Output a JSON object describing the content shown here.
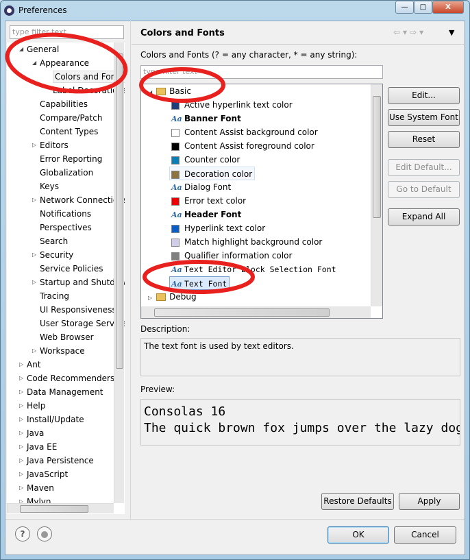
{
  "window": {
    "title": "Preferences",
    "minimize": "—",
    "maximize": "□",
    "close": "X"
  },
  "left": {
    "filter_placeholder": "type filter text",
    "tree": [
      {
        "label": "General",
        "level": 0,
        "arrow": "expanded"
      },
      {
        "label": "Appearance",
        "level": 1,
        "arrow": "expanded"
      },
      {
        "label": "Colors and Fonts",
        "level": 2,
        "arrow": "none",
        "selected": true
      },
      {
        "label": "Label Decorations",
        "level": 2,
        "arrow": "none"
      },
      {
        "label": "Capabilities",
        "level": 1,
        "arrow": "none"
      },
      {
        "label": "Compare/Patch",
        "level": 1,
        "arrow": "none"
      },
      {
        "label": "Content Types",
        "level": 1,
        "arrow": "none"
      },
      {
        "label": "Editors",
        "level": 1,
        "arrow": "collapsed"
      },
      {
        "label": "Error Reporting",
        "level": 1,
        "arrow": "none"
      },
      {
        "label": "Globalization",
        "level": 1,
        "arrow": "none"
      },
      {
        "label": "Keys",
        "level": 1,
        "arrow": "none"
      },
      {
        "label": "Network Connections",
        "level": 1,
        "arrow": "collapsed"
      },
      {
        "label": "Notifications",
        "level": 1,
        "arrow": "none"
      },
      {
        "label": "Perspectives",
        "level": 1,
        "arrow": "none"
      },
      {
        "label": "Search",
        "level": 1,
        "arrow": "none"
      },
      {
        "label": "Security",
        "level": 1,
        "arrow": "collapsed"
      },
      {
        "label": "Service Policies",
        "level": 1,
        "arrow": "none"
      },
      {
        "label": "Startup and Shutdown",
        "level": 1,
        "arrow": "collapsed"
      },
      {
        "label": "Tracing",
        "level": 1,
        "arrow": "none"
      },
      {
        "label": "UI Responsiveness",
        "level": 1,
        "arrow": "none"
      },
      {
        "label": "User Storage Service",
        "level": 1,
        "arrow": "none"
      },
      {
        "label": "Web Browser",
        "level": 1,
        "arrow": "none"
      },
      {
        "label": "Workspace",
        "level": 1,
        "arrow": "collapsed"
      },
      {
        "label": "Ant",
        "level": 0,
        "arrow": "collapsed"
      },
      {
        "label": "Code Recommenders",
        "level": 0,
        "arrow": "collapsed"
      },
      {
        "label": "Data Management",
        "level": 0,
        "arrow": "collapsed"
      },
      {
        "label": "Help",
        "level": 0,
        "arrow": "collapsed"
      },
      {
        "label": "Install/Update",
        "level": 0,
        "arrow": "collapsed"
      },
      {
        "label": "Java",
        "level": 0,
        "arrow": "collapsed"
      },
      {
        "label": "Java EE",
        "level": 0,
        "arrow": "collapsed"
      },
      {
        "label": "Java Persistence",
        "level": 0,
        "arrow": "collapsed"
      },
      {
        "label": "JavaScript",
        "level": 0,
        "arrow": "collapsed"
      },
      {
        "label": "Maven",
        "level": 0,
        "arrow": "collapsed"
      },
      {
        "label": "Mylyn",
        "level": 0,
        "arrow": "collapsed"
      }
    ]
  },
  "page": {
    "title": "Colors and Fonts",
    "filter_label": "Colors and Fonts (? = any character, * = any string):",
    "filter_placeholder": "type filter text",
    "categories": [
      {
        "label": "Basic",
        "expanded": true
      },
      {
        "label": "Debug",
        "expanded": false
      }
    ],
    "items": [
      {
        "label": "Active hyperlink text color",
        "kind": "color",
        "color": "#1f3f7a"
      },
      {
        "label": "Banner Font",
        "kind": "font",
        "bold": true
      },
      {
        "label": "Content Assist background color",
        "kind": "color",
        "color": "#ffffff"
      },
      {
        "label": "Content Assist foreground color",
        "kind": "color",
        "color": "#000000"
      },
      {
        "label": "Counter color",
        "kind": "color",
        "color": "#0b7fb5"
      },
      {
        "label": "Decoration color",
        "kind": "color",
        "color": "#8c7340",
        "focused": true
      },
      {
        "label": "Dialog Font",
        "kind": "font"
      },
      {
        "label": "Error text color",
        "kind": "color",
        "color": "#ee0000"
      },
      {
        "label": "Header Font",
        "kind": "font",
        "bold": true
      },
      {
        "label": "Hyperlink text color",
        "kind": "color",
        "color": "#0a5fc7"
      },
      {
        "label": "Match highlight background color",
        "kind": "color",
        "color": "#cfcdea"
      },
      {
        "label": "Qualifier information color",
        "kind": "color",
        "color": "#808080"
      },
      {
        "label": "Text Editor Block Selection Font",
        "kind": "font",
        "mono": true
      },
      {
        "label": "Text Font",
        "kind": "font",
        "mono": true,
        "selected": true
      }
    ],
    "buttons": {
      "edit": "Edit...",
      "use_system_font": "Use System Font",
      "reset": "Reset",
      "edit_default": "Edit Default...",
      "go_to_default": "Go to Default",
      "expand_all": "Expand All"
    },
    "description_label": "Description:",
    "description": "The text font is used by text editors.",
    "preview_label": "Preview:",
    "preview_line1": "Consolas 16",
    "preview_line2": "The quick brown fox jumps over the lazy dog.",
    "restore_defaults": "Restore Defaults",
    "apply": "Apply"
  },
  "footer": {
    "ok": "OK",
    "cancel": "Cancel",
    "help_icon": "?"
  },
  "annotation_color": "#e8201e"
}
